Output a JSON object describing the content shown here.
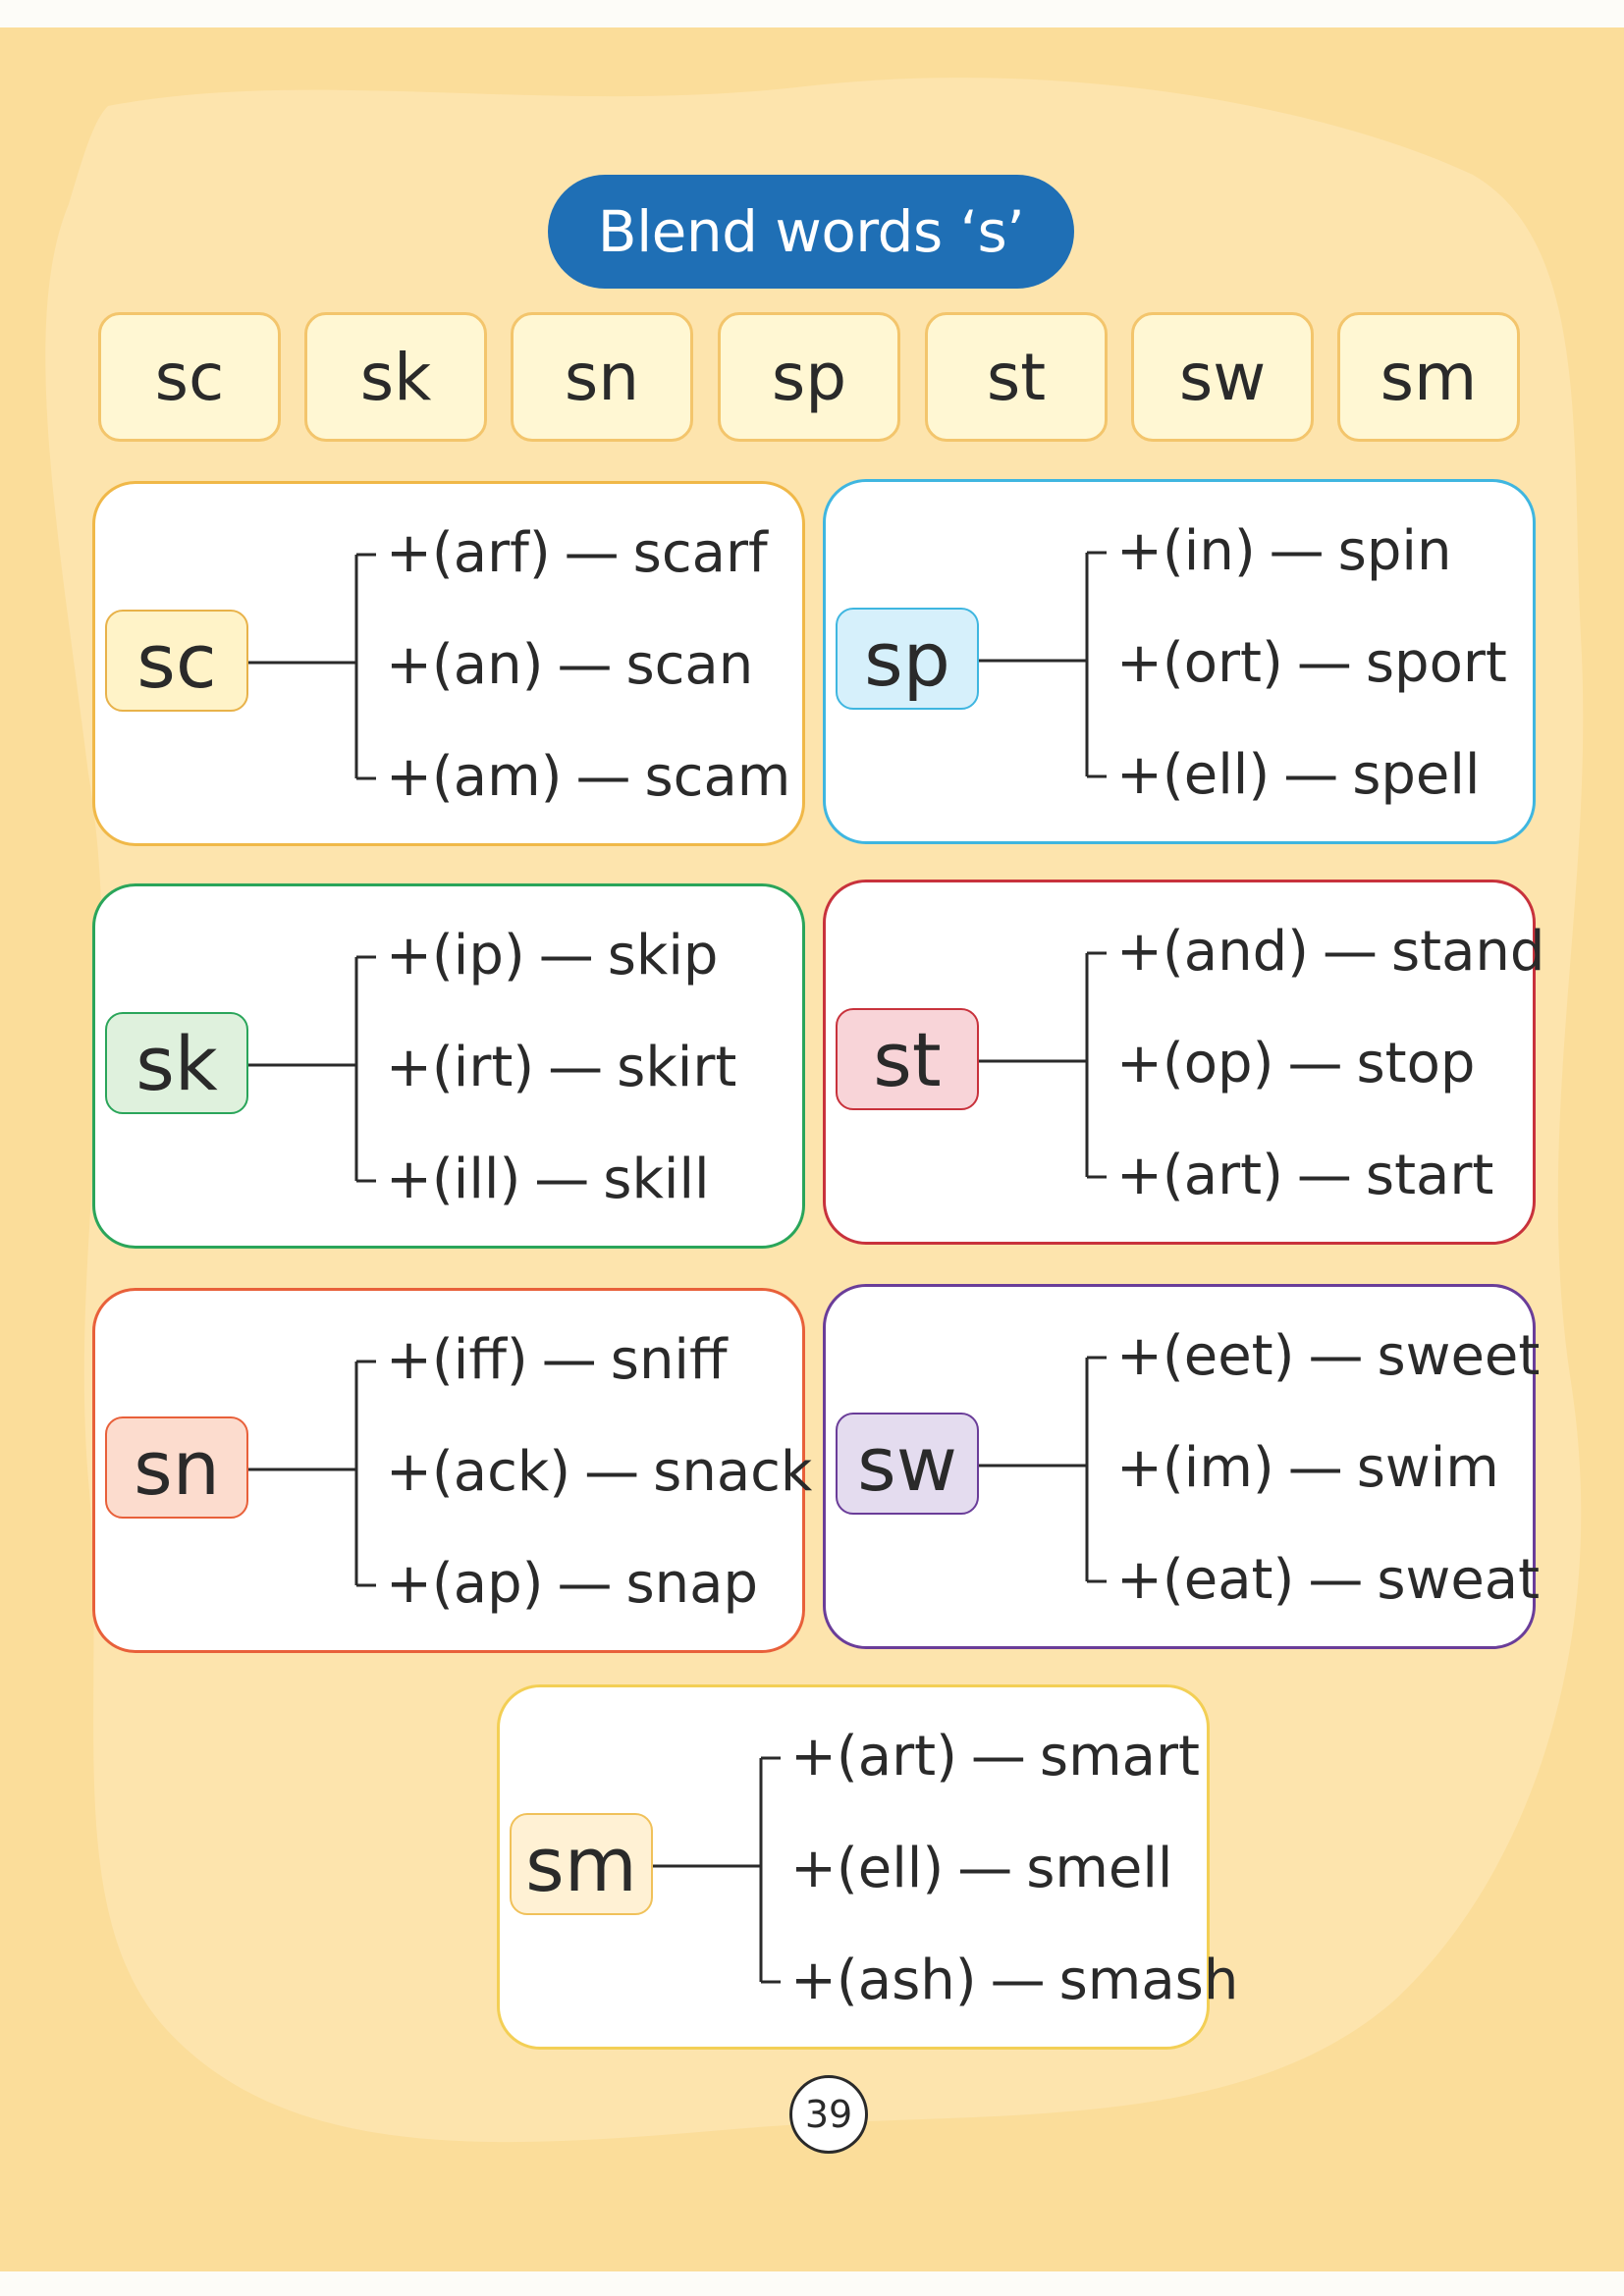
{
  "title": "Blend words ‘s’",
  "blends": [
    "sc",
    "sk",
    "sn",
    "sp",
    "st",
    "sw",
    "sm"
  ],
  "cards": [
    {
      "blend": "sc",
      "colors": {
        "border": "#f0b848",
        "badge_bg": "#fff3c8",
        "badge_border": "#e8b24a"
      },
      "rows": [
        {
          "ending": "+(arf)",
          "word": "scarf"
        },
        {
          "ending": "+(an)",
          "word": "scan"
        },
        {
          "ending": "+(am)",
          "word": "scam"
        }
      ]
    },
    {
      "blend": "sp",
      "colors": {
        "border": "#3fb6e0",
        "badge_bg": "#d6f0fb",
        "badge_border": "#3fb6e0"
      },
      "rows": [
        {
          "ending": "+(in)",
          "word": "spin"
        },
        {
          "ending": "+(ort)",
          "word": "sport"
        },
        {
          "ending": "+(ell)",
          "word": "spell"
        }
      ]
    },
    {
      "blend": "sk",
      "colors": {
        "border": "#2aa55a",
        "badge_bg": "#dff1dd",
        "badge_border": "#2aa55a"
      },
      "rows": [
        {
          "ending": "+(ip)",
          "word": "skip"
        },
        {
          "ending": "+(irt)",
          "word": "skirt"
        },
        {
          "ending": "+(ill)",
          "word": "skill"
        }
      ]
    },
    {
      "blend": "st",
      "colors": {
        "border": "#c8323c",
        "badge_bg": "#f8d4d8",
        "badge_border": "#c8323c"
      },
      "rows": [
        {
          "ending": "+(and)",
          "word": "stand"
        },
        {
          "ending": "+(op)",
          "word": "stop"
        },
        {
          "ending": "+(art)",
          "word": "start"
        }
      ]
    },
    {
      "blend": "sn",
      "colors": {
        "border": "#e8603a",
        "badge_bg": "#fcdcce",
        "badge_border": "#e8603a"
      },
      "rows": [
        {
          "ending": "+(iff)",
          "word": "sniff"
        },
        {
          "ending": "+(ack)",
          "word": "snack"
        },
        {
          "ending": "+(ap)",
          "word": "snap"
        }
      ]
    },
    {
      "blend": "sw",
      "colors": {
        "border": "#6a3d99",
        "badge_bg": "#e4dcef",
        "badge_border": "#6a3d99"
      },
      "rows": [
        {
          "ending": "+(eet)",
          "word": "sweet"
        },
        {
          "ending": "+(im)",
          "word": "swim"
        },
        {
          "ending": "+(eat)",
          "word": "sweat"
        }
      ]
    },
    {
      "blend": "sm",
      "colors": {
        "border": "#f3cf55",
        "badge_bg": "#fff1d4",
        "badge_border": "#f0c15a"
      },
      "rows": [
        {
          "ending": "+(art)",
          "word": "smart"
        },
        {
          "ending": "+(ell)",
          "word": "smell"
        },
        {
          "ending": "+(ash)",
          "word": "smash"
        }
      ]
    }
  ],
  "page_number": "39"
}
